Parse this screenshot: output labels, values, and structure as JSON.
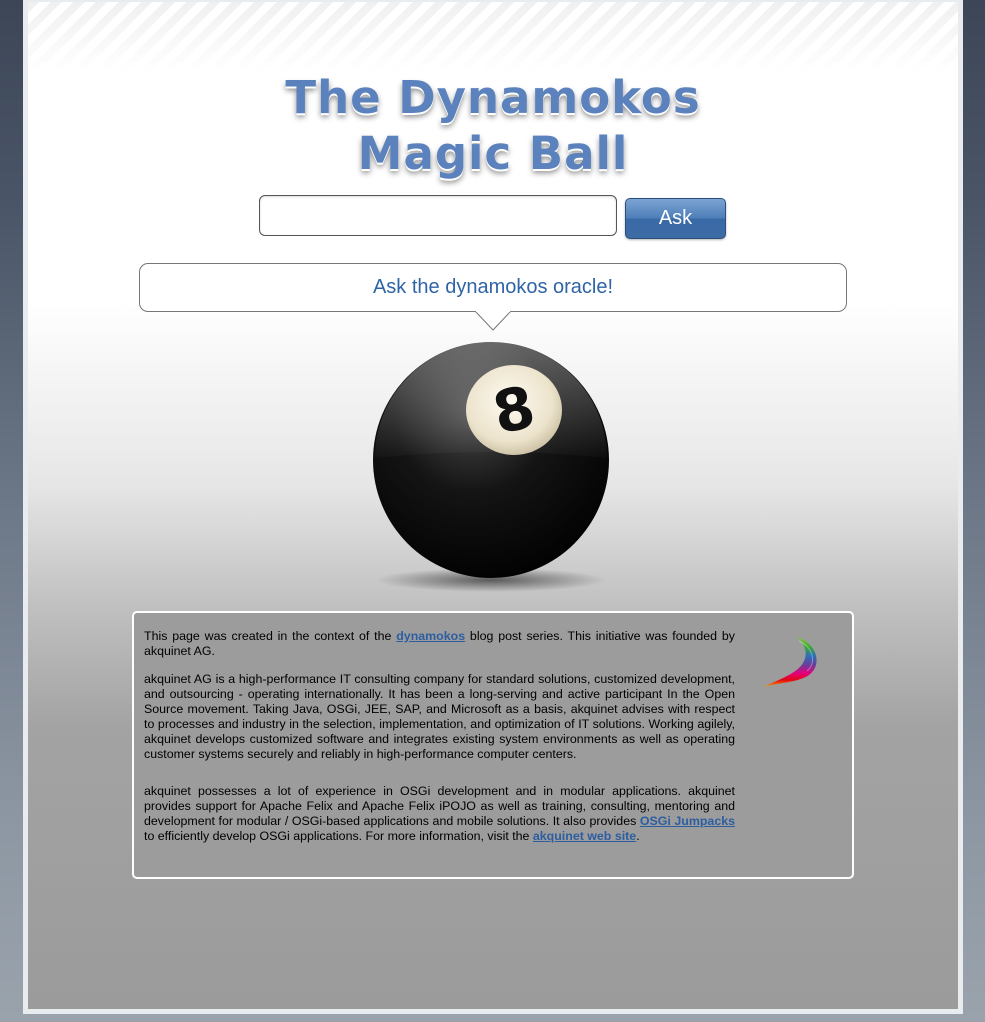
{
  "header": {
    "title_line1": "The Dynamokos",
    "title_line2": "Magic Ball"
  },
  "ask_form": {
    "input_value": "",
    "button_label": "Ask"
  },
  "oracle": {
    "bubble_text": "Ask the dynamokos oracle!",
    "ball_number": "8"
  },
  "info": {
    "p1": {
      "before_link": "This page was created in the context of the ",
      "link_text": "dynamokos",
      "after_link": " blog post series. This initiative was founded by akquinet AG."
    },
    "p2": "akquinet AG is a high-performance IT consulting company for standard solutions, customized development, and outsourcing - operating internationally. It has been a long-serving and active participant In the Open Source movement. Taking Java, OSGi, JEE, SAP, and Microsoft as a basis, akquinet advises with respect to processes and industry in the selection, implementation, and optimization of IT solutions. Working agilely, akquinet develops customized software and integrates existing system environments as well as operating customer systems securely and reliably in high-performance computer centers.",
    "p3": {
      "text1": "akquinet possesses a lot of experience in OSGi development and in modular applications. akquinet provides support for Apache Felix and Apache Felix iPOJO as well as training, consulting, mentoring and development for modular / OSGi-based applications and mobile solutions. It also provides ",
      "link1": "OSGi Jumpacks",
      "text2": " to efficiently develop OSGi applications. For more information, visit the ",
      "link2": "akquinet web site",
      "text3": "."
    }
  },
  "colors": {
    "title": "#5b82bd",
    "button": "#3c6ba6",
    "bubble_text": "#2f64a6",
    "link": "#2c5ea1"
  }
}
